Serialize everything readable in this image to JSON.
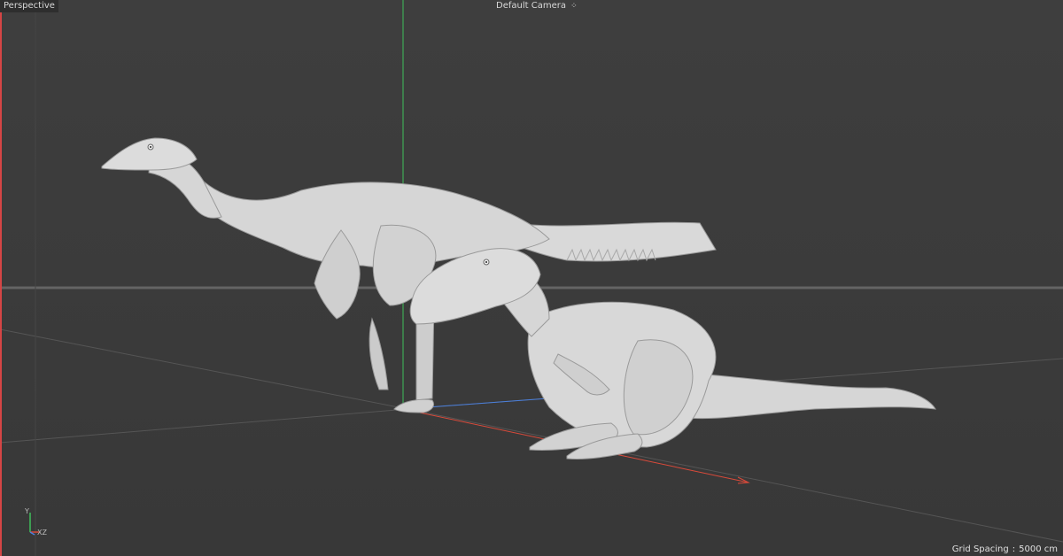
{
  "viewport": {
    "view_name": "Perspective",
    "camera_name": "Default Camera",
    "camera_icon": "camera-cycle-icon",
    "grid_spacing_label": "Grid Spacing",
    "grid_spacing_separator": ":",
    "grid_spacing_value": "5000 cm"
  },
  "axis_gizmo": {
    "y_label": "Y",
    "xz_label": "XZ",
    "colors": {
      "x": "#d94a3a",
      "y": "#3fbf5a",
      "z": "#4a7fdc"
    }
  },
  "models": [
    {
      "name": "feathered-theropod-standing",
      "color": "#d6d6d6"
    },
    {
      "name": "theropod-crouching",
      "color": "#d6d6d6"
    }
  ],
  "colors": {
    "background": "#3b3b3b",
    "grid_line": "#5a5a5a",
    "horizon": "#6e6e6e"
  }
}
